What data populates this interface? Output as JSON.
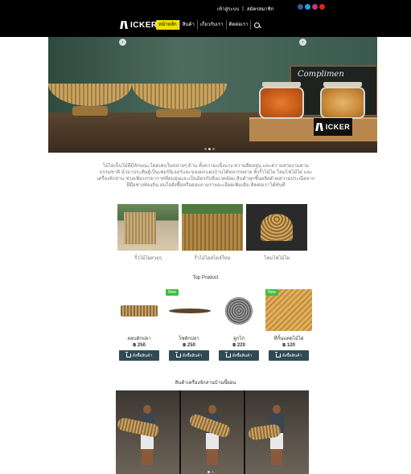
{
  "header": {
    "top_links": [
      "เข้าสู่ระบบ",
      "|",
      "สมัครสมาชิก"
    ],
    "logo_text": "ICKER",
    "nav": [
      {
        "label": "หน้าหลัก",
        "active": true
      },
      {
        "label": "สินค้า",
        "active": false
      },
      {
        "label": "เกี่ยวกับเรา",
        "active": false
      },
      {
        "label": "ติดต่อเรา",
        "active": false
      }
    ],
    "socials": [
      "facebook-icon",
      "twitter-icon",
      "instagram-icon",
      "youtube-icon"
    ],
    "accent": "#f0e000"
  },
  "hero": {
    "blackboard_text": "Complimen",
    "logo_text": "ICKER",
    "slide_count": 3,
    "active_slide": 2
  },
  "intro": {
    "text": "ไม้ไผ่เป็นไม้ที่มีลักษณะโดดเด่นในหลายๆ ด้าน ทั้งความแข็งแรง ความยืดหยุ่น และความสวยงามตามธรรมชาติ นำมาประดิษฐ์เป็นเฟอร์นิเจอร์และของตกแต่งบ้านได้หลากหลาย ทั้งรั้วไม้ไผ่ โคมไฟไม้ไผ่ และเครื่องจักสาน ช่วยเพิ่มบรรยากาศที่อบอุ่นและเป็นมิตรกับสิ่งแวดล้อม สินค้าทุกชิ้นผลิตด้วยความประณีตจากฝีมือช่างท้องถิ่น สนใจสั่งซื้อหรือสอบถามรายละเอียดเพิ่มเติม ติดต่อเราได้ทันที"
  },
  "categories": [
    {
      "label": "รั้วไม้ไผ่สวยๆ",
      "icon": "bamboo-fence-icon"
    },
    {
      "label": "รั้วไม้ไผ่สไตล์ใหม่",
      "icon": "bamboo-panel-icon"
    },
    {
      "label": "โคมไฟไม้ไผ่",
      "icon": "bamboo-lamp-icon"
    }
  ],
  "top_product": {
    "title": "Top Product",
    "buy_label": "สั่งซื้อสินค้า",
    "items": [
      {
        "name": "ลอบดักปลา",
        "price": "฿ 250",
        "new": false
      },
      {
        "name": "ไซดักปลา",
        "price": "฿ 250",
        "new": true
      },
      {
        "name": "ลูกไก่",
        "price": "฿ 220",
        "new": false
      },
      {
        "name": "ที่กั้นแดดไม้ไผ่",
        "price": "฿ 120",
        "new": true
      }
    ],
    "new_label": "New",
    "badge_color": "#3cbf3c",
    "button_color": "#2f4a55"
  },
  "bottom_section": {
    "title": "สินค้าเครื่องจักสานบ้านขี้ผ่อน"
  }
}
